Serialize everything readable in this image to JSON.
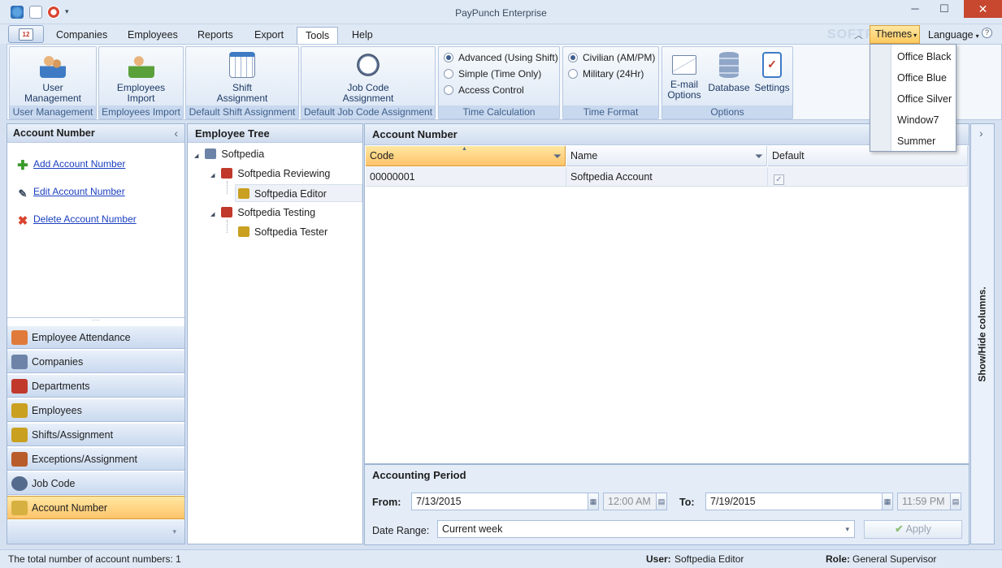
{
  "window": {
    "title": "PayPunch Enterprise",
    "minimize_symbol": "─",
    "maximize_symbol": "☐",
    "close_symbol": "✕",
    "app_button_badge": "12"
  },
  "menu_tabs": [
    {
      "label": "Companies"
    },
    {
      "label": "Employees"
    },
    {
      "label": "Reports"
    },
    {
      "label": "Export"
    },
    {
      "label": "Tools"
    },
    {
      "label": "Help"
    }
  ],
  "active_tab": "Tools",
  "themes": {
    "label": "Themes",
    "options": [
      "Office Black",
      "Office Blue",
      "Office Silver",
      "Window7",
      "Summer"
    ]
  },
  "language": {
    "label": "Language"
  },
  "watermark": "SOFTPEDIA",
  "ribbon": {
    "groups": {
      "user_management": {
        "button": [
          "User",
          "Management"
        ],
        "caption": "User Management"
      },
      "employees_import": {
        "button": [
          "Employees",
          "Import"
        ],
        "caption": "Employees Import"
      },
      "shift_assignment": {
        "button": [
          "Shift",
          "Assignment"
        ],
        "caption": "Default Shift Assignment"
      },
      "job_code": {
        "button": [
          "Job Code",
          "Assignment"
        ],
        "caption": "Default Job Code Assignment"
      },
      "time_calc": {
        "caption": "Time Calculation",
        "options": [
          "Advanced (Using Shift)",
          "Simple (Time Only)",
          "Access Control"
        ],
        "selected": 0
      },
      "time_format": {
        "caption": "Time Format",
        "options": [
          "Civilian (AM/PM)",
          "Military (24Hr)"
        ],
        "selected": 0
      },
      "options": {
        "caption": "Options",
        "buttons": [
          [
            "E-mail",
            "Options"
          ],
          [
            "Database"
          ],
          [
            "Settings"
          ]
        ]
      }
    }
  },
  "left_panel": {
    "title": "Account Number",
    "collapse_symbol": "‹",
    "actions": [
      {
        "label": "Add Account Number",
        "icon": "add-icon"
      },
      {
        "label": "Edit Account Number",
        "icon": "edit-icon"
      },
      {
        "label": "Delete Account Number",
        "icon": "delete-icon"
      }
    ],
    "nav": [
      {
        "label": "Employee Attendance",
        "icon": "attendance-icon",
        "color": "#e07a3a"
      },
      {
        "label": "Companies",
        "icon": "building-icon",
        "color": "#6d84a8"
      },
      {
        "label": "Departments",
        "icon": "departments-icon",
        "color": "#c0392b"
      },
      {
        "label": "Employees",
        "icon": "employees-icon",
        "color": "#c9a020"
      },
      {
        "label": "Shifts/Assignment",
        "icon": "calendar-icon",
        "color": "#c9a020"
      },
      {
        "label": "Exceptions/Assignment",
        "icon": "exceptions-icon",
        "color": "#b85c2c"
      },
      {
        "label": "Job Code",
        "icon": "clock-icon",
        "color": "#556b8d"
      },
      {
        "label": "Account Number",
        "icon": "account-icon",
        "color": "#d6b040"
      }
    ],
    "active_nav": "Account Number"
  },
  "employee_tree": {
    "title": "Employee Tree",
    "nodes": [
      {
        "label": "Softpedia",
        "level": 0,
        "expander": "◢"
      },
      {
        "label": "Softpedia Reviewing",
        "level": 1,
        "expander": "◢"
      },
      {
        "label": "Softpedia Editor",
        "level": 2,
        "expander": ""
      },
      {
        "label": "Softpedia Testing",
        "level": 1,
        "expander": "◢"
      },
      {
        "label": "Softpedia Tester",
        "level": 2,
        "expander": ""
      }
    ],
    "selected": "Softpedia Editor"
  },
  "grid": {
    "title": "Account Number",
    "columns": [
      "Code",
      "Name",
      "Default"
    ],
    "rows": [
      {
        "code": "00000001",
        "name": "Softpedia Account",
        "default": true
      }
    ],
    "check_symbol": "✓"
  },
  "accounting_period": {
    "title": "Accounting Period",
    "from_label": "From:",
    "from_date": "7/13/2015",
    "from_time": "12:00 AM",
    "to_label": "To:",
    "to_date": "7/19/2015",
    "to_time": "11:59 PM",
    "date_range_label": "Date Range:",
    "date_range_value": "Current week",
    "apply_label": "Apply"
  },
  "right_strip": {
    "label": "Show/Hide columns.",
    "collapse_symbol": "›"
  },
  "status_bar": {
    "count_text": "The total number of account numbers: 1",
    "user_label": "User:",
    "user_value": "Softpedia Editor",
    "role_label": "Role:",
    "role_value": "General Supervisor"
  }
}
